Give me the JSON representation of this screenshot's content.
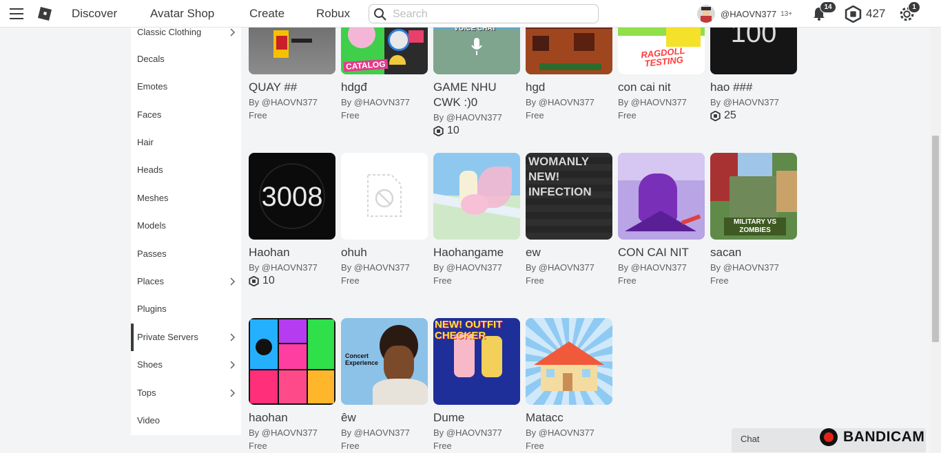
{
  "topbar": {
    "nav": [
      "Discover",
      "Avatar Shop",
      "Create",
      "Robux"
    ],
    "search_placeholder": "Search",
    "username": "@HAOVN377",
    "age_label": "13+",
    "notifications": "14",
    "robux": "427",
    "settings_badge": "1"
  },
  "sidebar": {
    "items": [
      {
        "label": "Classic Clothing",
        "chevron": true
      },
      {
        "label": "Decals",
        "chevron": false
      },
      {
        "label": "Emotes",
        "chevron": false
      },
      {
        "label": "Faces",
        "chevron": false
      },
      {
        "label": "Hair",
        "chevron": false
      },
      {
        "label": "Heads",
        "chevron": false
      },
      {
        "label": "Meshes",
        "chevron": false
      },
      {
        "label": "Models",
        "chevron": false
      },
      {
        "label": "Passes",
        "chevron": false
      },
      {
        "label": "Places",
        "chevron": true
      },
      {
        "label": "Plugins",
        "chevron": false
      },
      {
        "label": "Private Servers",
        "chevron": true,
        "active": true
      },
      {
        "label": "Shoes",
        "chevron": true
      },
      {
        "label": "Tops",
        "chevron": true
      },
      {
        "label": "Video",
        "chevron": false
      }
    ]
  },
  "items": [
    {
      "name": "QUAY ##",
      "by": "By @HAOVN377",
      "price": "Free",
      "robux": false,
      "thumb_text": ""
    },
    {
      "name": "hdgđ",
      "by": "By @HAOVN377",
      "price": "Free",
      "robux": false,
      "thumb_text": "CATALOG"
    },
    {
      "name": "GAME NHU CWK :)0",
      "by": "By @HAOVN377",
      "price": "10",
      "robux": true,
      "thumb_text": "VOICE CHAT"
    },
    {
      "name": "hgd",
      "by": "By @HAOVN377",
      "price": "Free",
      "robux": false,
      "thumb_text": ""
    },
    {
      "name": "con cai nit",
      "by": "By @HAOVN377",
      "price": "Free",
      "robux": false,
      "thumb_text": "RAGDOLL TESTING"
    },
    {
      "name": "hao ###",
      "by": "By @HAOVN377",
      "price": "25",
      "robux": true,
      "thumb_text": "100"
    },
    {
      "name": "Haohan",
      "by": "By @HAOVN377",
      "price": "10",
      "robux": true,
      "thumb_text": "3008"
    },
    {
      "name": "ohuh",
      "by": "By @HAOVN377",
      "price": "Free",
      "robux": false,
      "thumb_text": ""
    },
    {
      "name": "Haohangame",
      "by": "By @HAOVN377",
      "price": "Free",
      "robux": false,
      "thumb_text": ""
    },
    {
      "name": "ew",
      "by": "By @HAOVN377",
      "price": "Free",
      "robux": false,
      "thumb_text": "WOMANLY NEW! INFECTION"
    },
    {
      "name": "CON CAI NIT",
      "by": "By @HAOVN377",
      "price": "Free",
      "robux": false,
      "thumb_text": ""
    },
    {
      "name": "sacan",
      "by": "By @HAOVN377",
      "price": "Free",
      "robux": false,
      "thumb_text": "MILITARY VS ZOMBIES"
    },
    {
      "name": "haohan",
      "by": "By @HAOVN377",
      "price": "Free",
      "robux": false,
      "thumb_text": ""
    },
    {
      "name": "êw",
      "by": "By @HAOVN377",
      "price": "Free",
      "robux": false,
      "thumb_text": "Concert Experience"
    },
    {
      "name": "Dume",
      "by": "By @HAOVN377",
      "price": "Free",
      "robux": false,
      "thumb_text": "NEW! OUTFIT CHECKER"
    },
    {
      "name": "Matacc",
      "by": "By @HAOVN377",
      "price": "Free",
      "robux": false,
      "thumb_text": ""
    }
  ],
  "chat": {
    "label": "Chat"
  },
  "watermark": {
    "text": "BANDICAM"
  },
  "colors": {
    "accent": "#393b3d",
    "background": "#f2f4f5",
    "card_bg": "#ffffff"
  }
}
